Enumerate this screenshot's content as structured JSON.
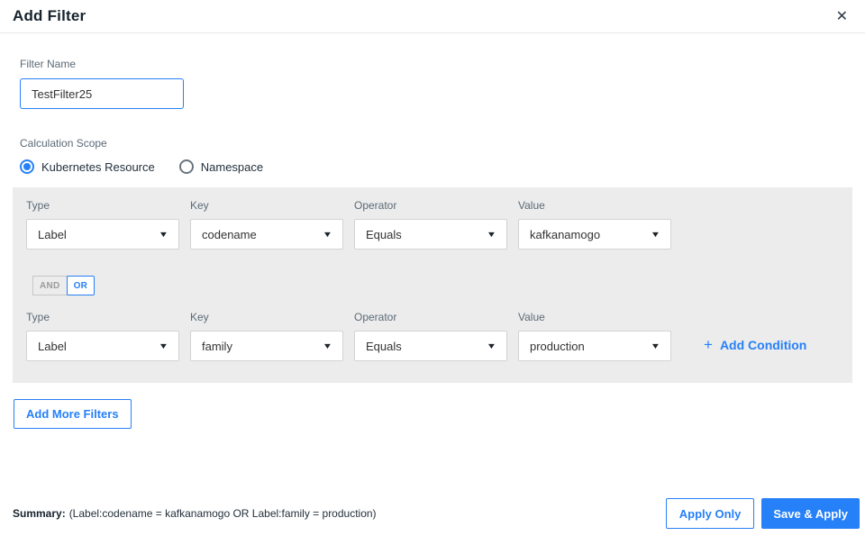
{
  "colors": {
    "accent": "#2680f8",
    "panel_bg": "#ececec"
  },
  "icons": {
    "close": "✕",
    "caret": "▼",
    "plus": "+"
  },
  "header": {
    "title": "Add Filter"
  },
  "filter_name": {
    "label": "Filter Name",
    "value": "TestFilter25"
  },
  "calculation_scope": {
    "label": "Calculation Scope",
    "options": [
      {
        "label": "Kubernetes Resource",
        "selected": true
      },
      {
        "label": "Namespace",
        "selected": false
      }
    ]
  },
  "conditions": {
    "rows": [
      {
        "fields": [
          {
            "label": "Type",
            "value": "Label"
          },
          {
            "label": "Key",
            "value": "codename"
          },
          {
            "label": "Operator",
            "value": "Equals"
          },
          {
            "label": "Value",
            "value": "kafkanamogo"
          }
        ]
      },
      {
        "fields": [
          {
            "label": "Type",
            "value": "Label"
          },
          {
            "label": "Key",
            "value": "family"
          },
          {
            "label": "Operator",
            "value": "Equals"
          },
          {
            "label": "Value",
            "value": "production"
          }
        ]
      }
    ],
    "logic_toggle": {
      "and_label": "AND",
      "or_label": "OR",
      "selected": "OR"
    },
    "add_condition_label": "Add Condition"
  },
  "add_more_filters_label": "Add More Filters",
  "footer": {
    "summary_label": "Summary:",
    "summary_text": "(Label:codename = kafkanamogo OR Label:family = production)",
    "apply_only_label": "Apply Only",
    "save_apply_label": "Save & Apply"
  }
}
